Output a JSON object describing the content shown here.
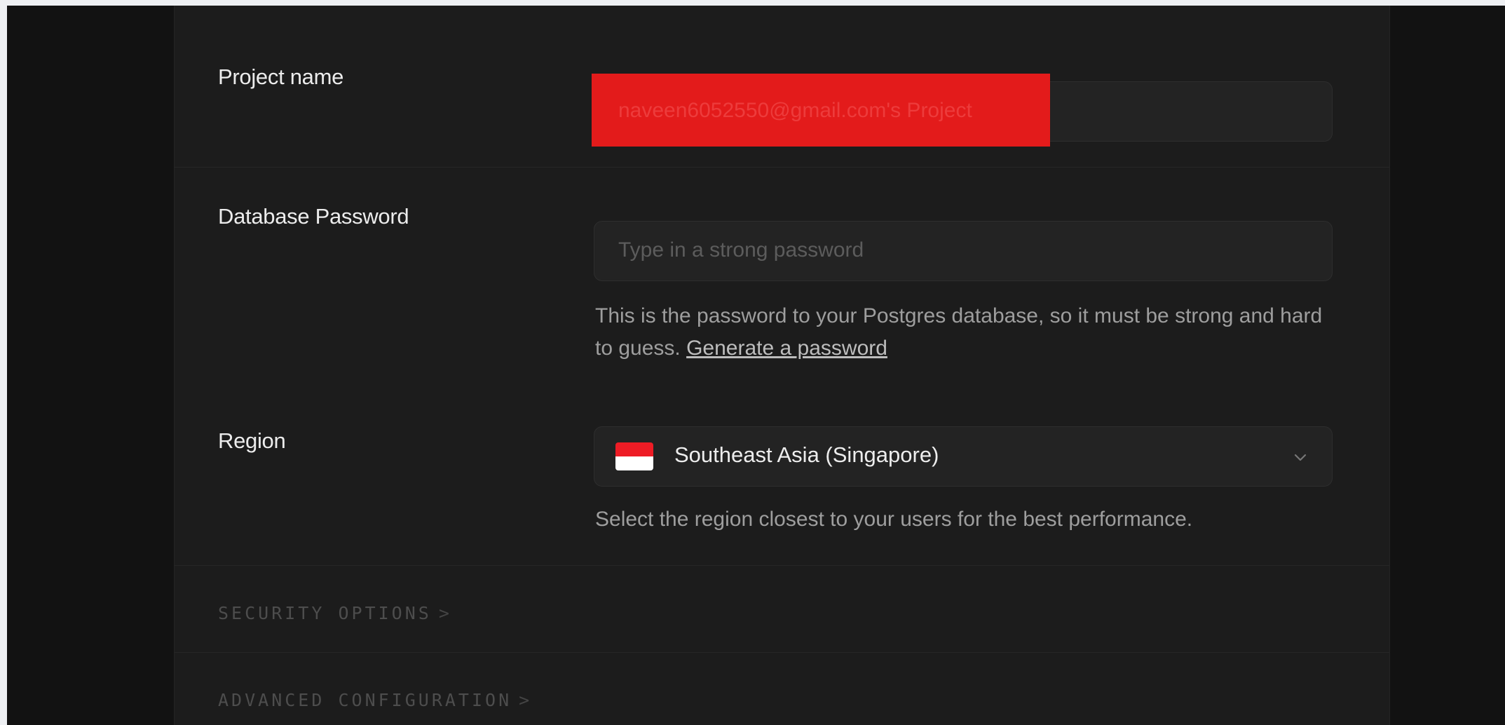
{
  "form": {
    "project_name": {
      "label": "Project name",
      "value": "naveen6052550@gmail.com's Project"
    },
    "database_password": {
      "label": "Database Password",
      "placeholder": "Type in a strong password",
      "help_text": "This is the password to your Postgres database, so it must be strong and hard to guess.",
      "generate_link": "Generate a password"
    },
    "region": {
      "label": "Region",
      "flag_icon": "singapore-flag-icon",
      "selected": "Southeast Asia (Singapore)",
      "help_text": "Select the region closest to your users for the best performance."
    }
  },
  "sections": {
    "security": "SECURITY OPTIONS",
    "advanced": "ADVANCED CONFIGURATION",
    "arrow": ">"
  },
  "colors": {
    "background": "#121212",
    "panel": "#1c1c1c",
    "redaction": "#e31b1b"
  }
}
